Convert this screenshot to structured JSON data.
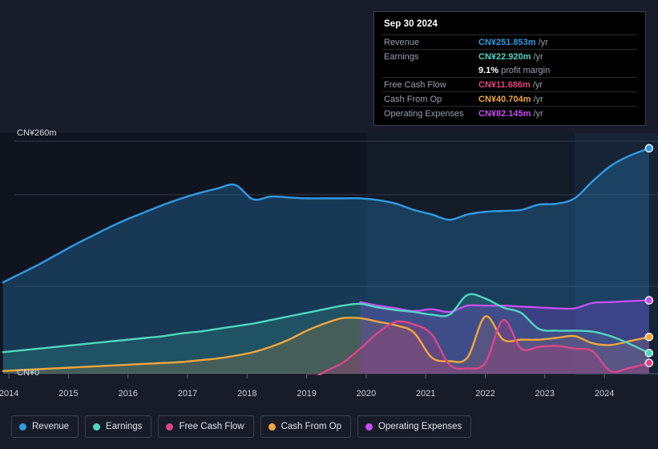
{
  "tooltip": {
    "date": "Sep 30 2024",
    "rows": [
      {
        "label": "Revenue",
        "value": "CN¥251.853m",
        "unit": "/yr",
        "color": "#2f9ae3"
      },
      {
        "label": "Earnings",
        "value": "CN¥22.920m",
        "unit": "/yr",
        "color": "#4fd6c0"
      },
      {
        "label": "Free Cash Flow",
        "value": "CN¥11.686m",
        "unit": "/yr",
        "color": "#e0457b"
      },
      {
        "label": "Cash From Op",
        "value": "CN¥40.704m",
        "unit": "/yr",
        "color": "#efa63c"
      },
      {
        "label": "Operating Expenses",
        "value": "CN¥82.145m",
        "unit": "/yr",
        "color": "#c44ff0"
      }
    ],
    "profit_margin_value": "9.1%",
    "profit_margin_note": "profit margin"
  },
  "axes": {
    "y_top_label": "CN¥260m",
    "y_zero_label": "CN¥0",
    "y_max": 260,
    "y_min": 0,
    "y_unit": "CN¥m",
    "x_ticks": [
      "2014",
      "2015",
      "2016",
      "2017",
      "2018",
      "2019",
      "2020",
      "2021",
      "2022",
      "2023",
      "2024"
    ],
    "gridlines_y": [
      260,
      200,
      97.5,
      0
    ]
  },
  "legend": {
    "items": [
      {
        "label": "Revenue",
        "color": "#2f9ae3"
      },
      {
        "label": "Earnings",
        "color": "#4fd6c0"
      },
      {
        "label": "Free Cash Flow",
        "color": "#d9468a"
      },
      {
        "label": "Cash From Op",
        "color": "#efa63c"
      },
      {
        "label": "Operating Expenses",
        "color": "#c44ff0"
      }
    ]
  },
  "chart_data": {
    "type": "area",
    "title": "",
    "xlabel": "",
    "ylabel": "CN¥m",
    "ylim": [
      0,
      260
    ],
    "xlim": [
      2013.85,
      2024.9
    ],
    "grid": true,
    "legend_position": "bottom-left",
    "annotations": [
      {
        "type": "vertical-band",
        "label": "forecast-shading-start",
        "x": 2020.0
      },
      {
        "type": "vertical-band",
        "label": "secondary-band-start",
        "x": 2023.5
      }
    ],
    "x": [
      2013.9,
      2014.2,
      2014.5,
      2014.8,
      2015.1,
      2015.4,
      2015.7,
      2016.0,
      2016.3,
      2016.6,
      2016.9,
      2017.2,
      2017.5,
      2017.8,
      2018.1,
      2018.4,
      2018.7,
      2019.0,
      2019.3,
      2019.6,
      2019.9,
      2020.2,
      2020.5,
      2020.8,
      2021.1,
      2021.4,
      2021.7,
      2022.0,
      2022.3,
      2022.6,
      2022.9,
      2023.2,
      2023.5,
      2023.8,
      2024.1,
      2024.4,
      2024.75
    ],
    "series": [
      {
        "name": "Revenue",
        "color": "#2f9ae3",
        "fill": "rgba(33,110,160,0.42)",
        "values": [
          102,
          112,
          122,
          133,
          144,
          154,
          164,
          173,
          181,
          189,
          196,
          202,
          207,
          211,
          195,
          198,
          197,
          196,
          196,
          196,
          196,
          194,
          190,
          183,
          178,
          172,
          178,
          181,
          182,
          183,
          189,
          190,
          196,
          215,
          232,
          243,
          252
        ]
      },
      {
        "name": "Earnings",
        "color": "#4fd6c0",
        "fill": "rgba(45,120,120,0.40)",
        "values": [
          24,
          26,
          28,
          30,
          32,
          34,
          36,
          38,
          40,
          42,
          45,
          47,
          50,
          53,
          56,
          60,
          64,
          68,
          72,
          76,
          78,
          74,
          71,
          69,
          66,
          66,
          88,
          84,
          74,
          68,
          50,
          48,
          48,
          47,
          42,
          34,
          23
        ]
      },
      {
        "name": "Free Cash Flow",
        "color": "#d9468a",
        "fill": "rgba(170,60,120,0.32)",
        "values": [
          null,
          null,
          null,
          null,
          null,
          null,
          null,
          null,
          null,
          null,
          null,
          null,
          null,
          null,
          null,
          null,
          null,
          -10,
          2,
          12,
          28,
          46,
          58,
          55,
          44,
          10,
          6,
          12,
          60,
          28,
          30,
          31,
          28,
          25,
          3,
          6,
          12
        ]
      },
      {
        "name": "Cash From Op",
        "color": "#efa63c",
        "fill": "rgba(180,130,60,0.26)",
        "values": [
          3,
          4,
          5,
          6,
          7,
          8,
          9,
          10,
          11,
          12,
          13,
          15,
          17,
          20,
          24,
          30,
          38,
          48,
          56,
          62,
          62,
          58,
          54,
          46,
          18,
          14,
          18,
          64,
          38,
          38,
          38,
          40,
          42,
          34,
          32,
          36,
          41
        ]
      },
      {
        "name": "Operating Expenses",
        "color": "#c44ff0",
        "fill": "rgba(110,70,190,0.40)",
        "values": [
          null,
          null,
          null,
          null,
          null,
          null,
          null,
          null,
          null,
          null,
          null,
          null,
          null,
          null,
          null,
          null,
          null,
          null,
          null,
          null,
          80,
          76,
          73,
          70,
          72,
          69,
          76,
          76,
          76,
          75,
          74,
          73,
          73,
          79,
          80,
          81,
          82
        ]
      }
    ]
  }
}
